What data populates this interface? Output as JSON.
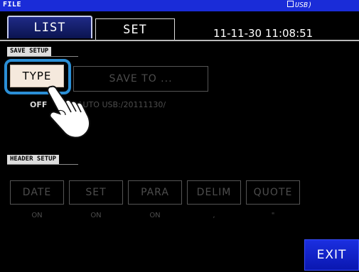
{
  "header": {
    "file_label": "FILE",
    "usb_label": "USB)"
  },
  "tabs": [
    {
      "label": "LIST",
      "active": false
    },
    {
      "label": "SET",
      "active": true
    }
  ],
  "datetime": "11-11-30 11:08:51",
  "save_setup": {
    "section_label": "SAVE SETUP",
    "type_button": "TYPE",
    "type_value": "OFF",
    "save_to_button": "SAVE TO ...",
    "save_to_value": "AUTO  USB:/20111130/"
  },
  "header_setup": {
    "section_label": "HEADER SETUP",
    "buttons": [
      {
        "label": "DATE",
        "value": "ON"
      },
      {
        "label": "SET",
        "value": "ON"
      },
      {
        "label": "PARA",
        "value": "ON"
      },
      {
        "label": "DELIM",
        "value": ","
      },
      {
        "label": "QUOTE",
        "value": "\""
      }
    ]
  },
  "exit_label": "EXIT",
  "colors": {
    "title_bar": "#1a2cd8",
    "exit": "#1b2fe0",
    "highlight": "#2b8fd6",
    "type_button": "#f5e9dd"
  },
  "icons": {
    "pointer": "pointing-hand-icon",
    "usb": "usb-icon"
  }
}
